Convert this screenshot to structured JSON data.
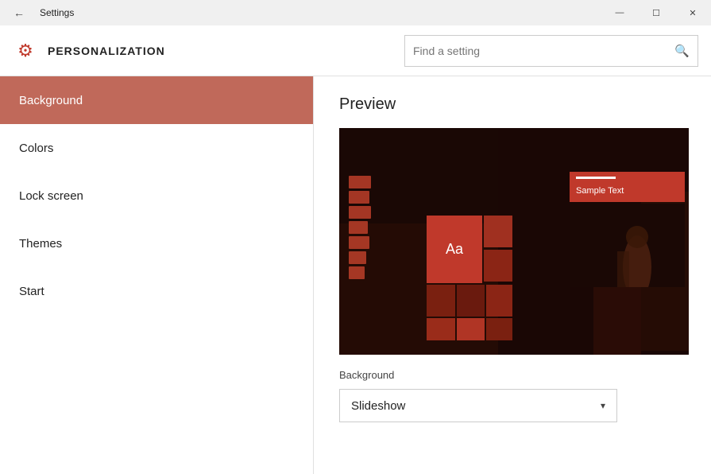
{
  "titlebar": {
    "title": "Settings",
    "minimize_label": "—",
    "maximize_label": "☐",
    "close_label": "✕"
  },
  "header": {
    "icon": "⚙",
    "title": "PERSONALIZATION",
    "search_placeholder": "Find a setting",
    "search_icon": "🔍"
  },
  "sidebar": {
    "items": [
      {
        "label": "Background",
        "active": true
      },
      {
        "label": "Colors",
        "active": false
      },
      {
        "label": "Lock screen",
        "active": false
      },
      {
        "label": "Themes",
        "active": false
      },
      {
        "label": "Start",
        "active": false
      }
    ]
  },
  "content": {
    "preview_title": "Preview",
    "aa_text": "Aa",
    "sample_text": "Sample Text",
    "background_label": "Background",
    "dropdown_value": "Slideshow",
    "dropdown_chevron": "▾"
  }
}
